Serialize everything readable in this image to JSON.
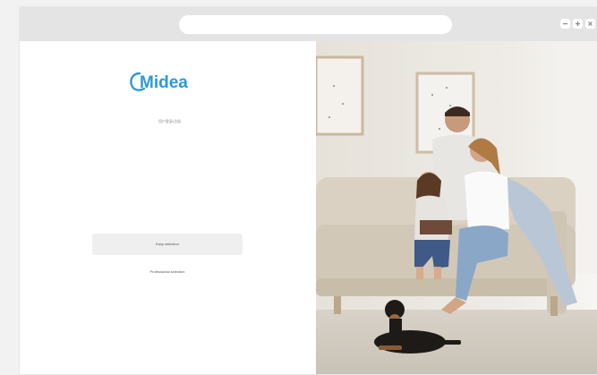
{
  "browser": {
    "address_text": ""
  },
  "brand": {
    "logo_text": "Midea",
    "color": "#2c9ad6"
  },
  "login": {
    "subtitle": "用户登录/注册",
    "easy_selection_label": "Easy selection",
    "professional_selection_label": "Professional selection"
  }
}
